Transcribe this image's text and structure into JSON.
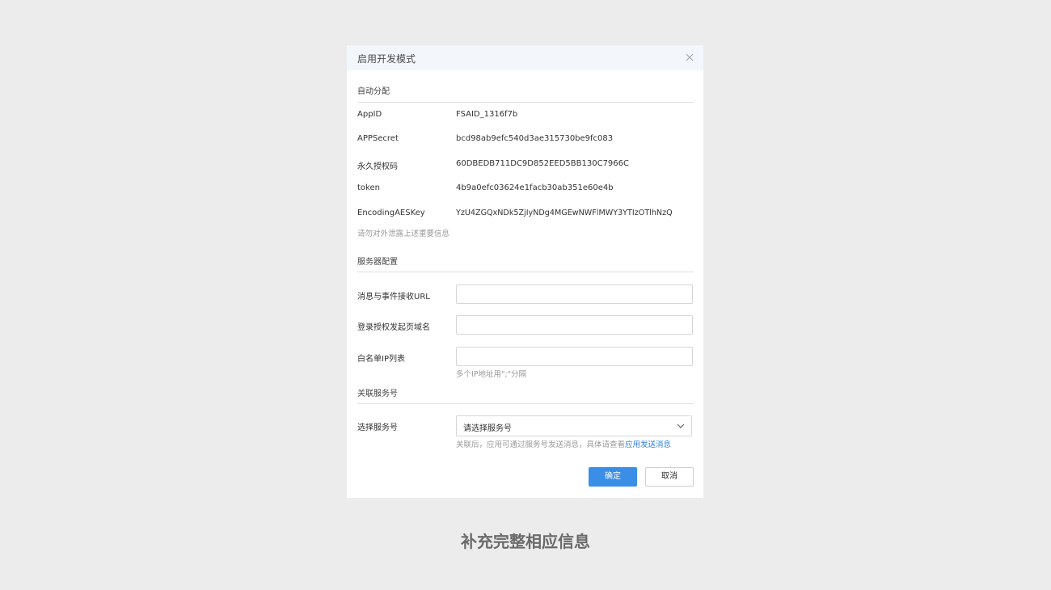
{
  "dialog": {
    "title": "启用开发模式",
    "close_icon": "close-icon"
  },
  "auto_assign": {
    "section_title": "自动分配",
    "rows": [
      {
        "label": "AppID",
        "value": "FSAID_1316f7b"
      },
      {
        "label": "APPSecret",
        "value": "bcd98ab9efc540d3ae315730be9fc083"
      },
      {
        "label": "永久授权码",
        "value": "60DBEDB711DC9D852EED5BB130C7966C"
      },
      {
        "label": "token",
        "value": "4b9a0efc03624e1facb30ab351e60e4b"
      },
      {
        "label": "EncodingAESKey",
        "value": "YzU4ZGQxNDk5ZjIyNDg4MGEwNWFlMWY3YTIzOTlhNzQ"
      }
    ],
    "warning": "请勿对外泄露上述重要信息"
  },
  "server_config": {
    "section_title": "服务器配置",
    "fields": [
      {
        "label": "消息与事件接收URL",
        "value": ""
      },
      {
        "label": "登录授权发起页域名",
        "value": ""
      },
      {
        "label": "白名单IP列表",
        "value": ""
      }
    ],
    "ip_hint": "多个IP地址用\";\"分隔"
  },
  "linked_service": {
    "section_title": "关联服务号",
    "select_label": "选择服务号",
    "select_value": "请选择服务号",
    "hint_prefix": "关联后，应用可通过服务号发送消息，具体请查看",
    "hint_link": "应用发送消息"
  },
  "buttons": {
    "confirm": "确定",
    "cancel": "取消"
  },
  "caption": "补充完整相应信息",
  "colors": {
    "primary": "#3a8ee6",
    "link": "#2f7ed8",
    "header_bg": "#f3f6fa",
    "page_bg": "#ececec"
  }
}
